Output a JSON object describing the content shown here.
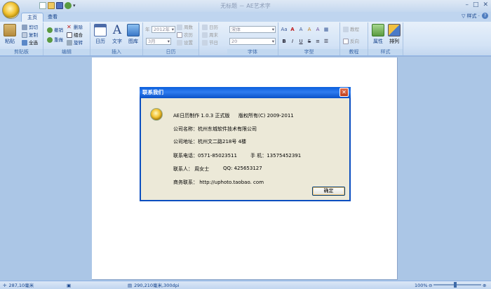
{
  "window": {
    "title": "无标题 － AE艺术字",
    "controls": {
      "minimize": "–",
      "maximize": "□",
      "close": "✕"
    }
  },
  "tabs": [
    {
      "label": "主页",
      "active": true
    },
    {
      "label": "查看",
      "active": false
    }
  ],
  "style_menu": "▽ 样式 ·",
  "help_icon": "?",
  "ribbon": {
    "clipboard": {
      "title": "剪贴板",
      "paste": "粘贴",
      "cut": "剪切",
      "copy": "复制",
      "select_all": "全选"
    },
    "edit": {
      "title": "编辑",
      "undo": "撤销",
      "redo": "重做",
      "delete": "删除",
      "group": "组合",
      "rotate": "旋转"
    },
    "insert": {
      "title": "插入",
      "calendar": "日历",
      "text": "文字",
      "image": "图库"
    },
    "calendar": {
      "title": "日历",
      "year_label": "年",
      "year_value": "2012年",
      "month_value": "3月",
      "weekday": "周数",
      "lunar": "农历",
      "settings": "设置"
    },
    "calendar2": {
      "calendar": "日历",
      "weekend": "周末",
      "holiday": "节日"
    },
    "font": {
      "title": "字体",
      "font_name": "宋体",
      "font_size": "20"
    },
    "glyph": {
      "title": "字型",
      "bold": "B",
      "italic": "I",
      "underline": "U",
      "strike": "S"
    },
    "tutorial": {
      "title": "教程",
      "tutorial": "教程",
      "reverse": "反向"
    },
    "style": {
      "title": "样式",
      "attribute": "属性",
      "arrange": "排列"
    }
  },
  "dialog": {
    "title": "联系我们",
    "close": "✕",
    "version": "AE日历制作 1.0.3 正式版",
    "copyright": "版权所有(C)  2009-2011",
    "company_name": "公司名称：杭州东城软件技术有限公司",
    "company_address": "公司地址：杭州文二路218号 4楼",
    "phone": "联系电话：0571-85023511",
    "mobile": "手      机：13575452391",
    "contact": "联系人：   周女士",
    "qq": "QQ:  425653127",
    "business": "商务联系：  http://uphoto.taobao. com",
    "ok": "确定"
  },
  "status": {
    "position": "287,10毫米",
    "page_size": "290,210毫米,300dpi",
    "zoom": "100%",
    "zoom_fraction": 0.46
  },
  "colors": {
    "accent": "#15428b",
    "dialog_title": "#0a5fdc",
    "ribbon_bg": "#d3e3f6"
  }
}
